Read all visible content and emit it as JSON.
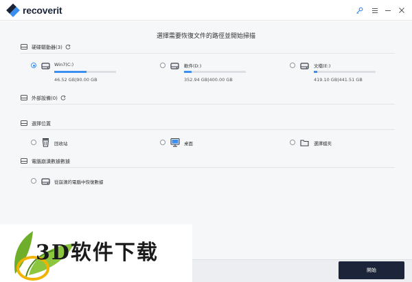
{
  "app": {
    "name": "recoverit"
  },
  "heading": "選擇需要恢復文件的路徑並開始掃描",
  "colors": {
    "accent": "#3b8ff0",
    "dark": "#1b2438",
    "background": "#f6f7f9"
  },
  "sections": {
    "hard_drives": {
      "label": "硬碟驅動器(3)",
      "drives": [
        {
          "label": "Win7(C:)",
          "usage": "46.52 GB|90.00 GB",
          "used_fraction": 0.52,
          "selected": true
        },
        {
          "label": "軟件(D:)",
          "usage": "352.94 GB|400.00 GB",
          "used_fraction": 0.12,
          "selected": false
        },
        {
          "label": "文檔(E:)",
          "usage": "419.10 GB|441.51 GB",
          "used_fraction": 0.06,
          "selected": false
        }
      ]
    },
    "external": {
      "label": "外部設備(0)"
    },
    "locations": {
      "label": "選擇位置",
      "items": [
        {
          "label": "回收站",
          "icon": "recycle-bin-icon"
        },
        {
          "label": "桌面",
          "icon": "desktop-icon"
        },
        {
          "label": "選擇檔夾",
          "icon": "folder-icon"
        }
      ]
    },
    "crashed": {
      "label": "電腦崩潰數據數據",
      "items": [
        {
          "label": "從崩潰的電腦中恢復數據",
          "icon": "crashed-drive-icon"
        }
      ]
    }
  },
  "footer": {
    "start_label": "開始"
  },
  "watermark": {
    "text": "3D软件下载",
    "icon": "leaf-logo-icon"
  }
}
